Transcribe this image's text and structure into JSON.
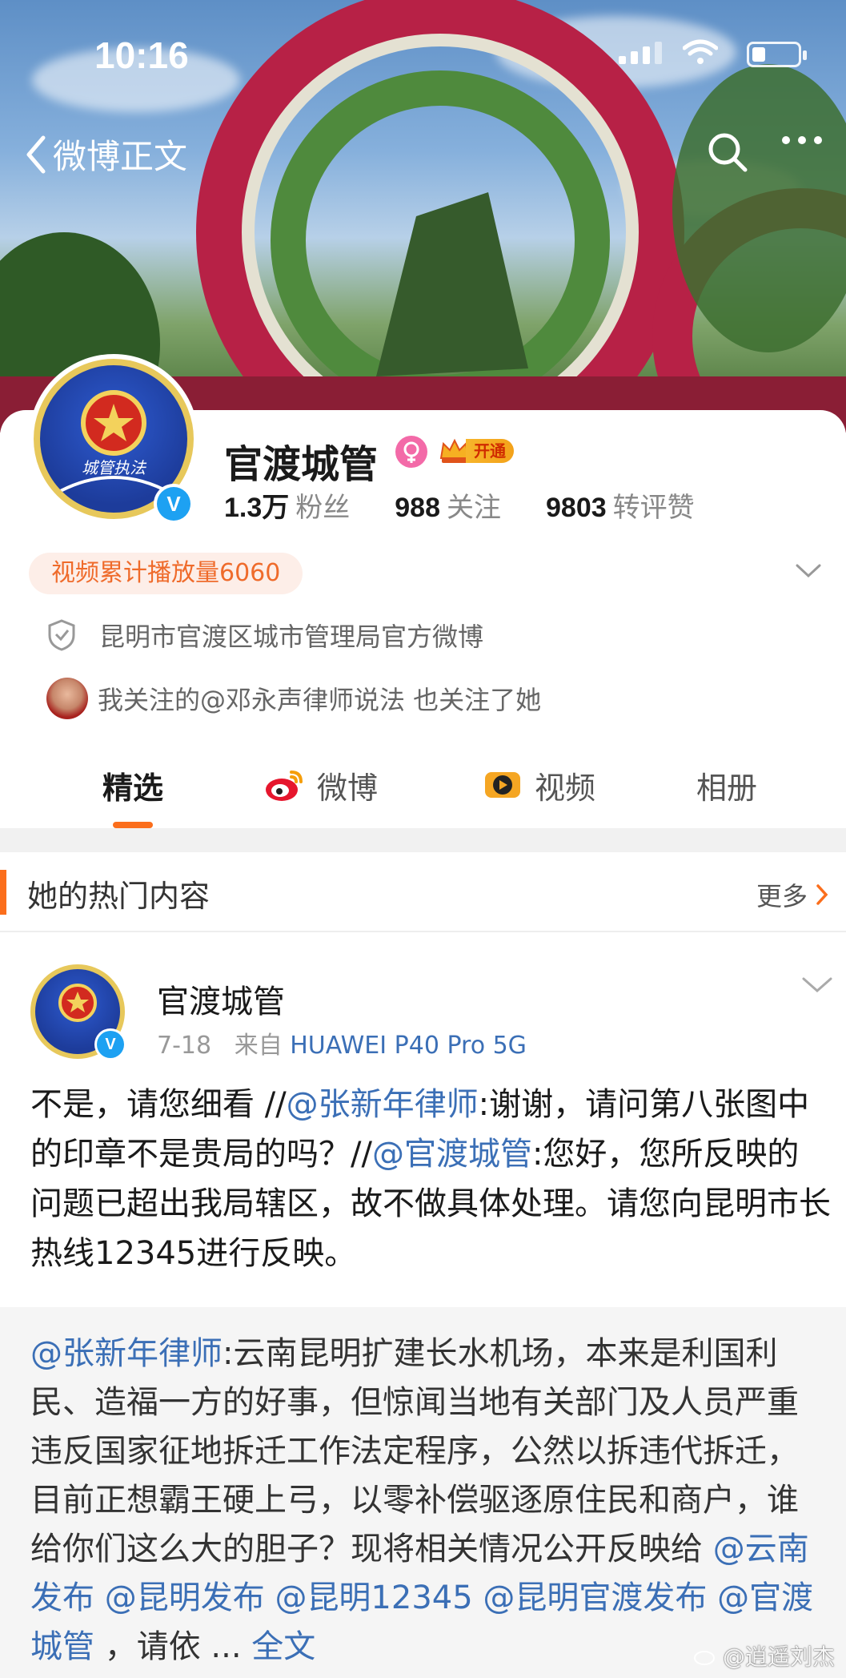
{
  "status_bar": {
    "time": "10:16"
  },
  "nav": {
    "back_label": "微博正文"
  },
  "profile": {
    "name": "官渡城管",
    "vip_label": "开通",
    "verified_mark": "V",
    "avatar_text": "城管执法",
    "stats": [
      {
        "value": "1.3万",
        "label": "粉丝"
      },
      {
        "value": "988",
        "label": "关注"
      },
      {
        "value": "9803",
        "label": "转评赞"
      }
    ],
    "video_badge": "视频累计播放量6060",
    "verify_text": "昆明市官渡区城市管理局官方微博",
    "mutual_text": "我关注的@邓永声律师说法  也关注了她"
  },
  "tabs": [
    {
      "label": "精选",
      "active": true
    },
    {
      "label": "微博",
      "icon": "weibo-icon"
    },
    {
      "label": "视频",
      "icon": "video-icon"
    },
    {
      "label": "相册"
    }
  ],
  "hot_section": {
    "title": "她的热门内容",
    "more_label": "更多"
  },
  "post": {
    "author": "官渡城管",
    "date": "7-18",
    "source_prefix": "来自",
    "device": "HUAWEI P40 Pro 5G",
    "text_parts": [
      {
        "t": "不是，请您细看 //"
      },
      {
        "t": "@张新年律师",
        "mention": true
      },
      {
        "t": ":谢谢，请问第八张图中的印章不是贵局的吗？//"
      },
      {
        "t": "@官渡城管",
        "mention": true
      },
      {
        "t": ":您好，您所反映的问题已超出我局辖区，故不做具体处理。请您向昆明市长热线12345进行反映。"
      }
    ]
  },
  "repost": {
    "parts": [
      {
        "t": "@张新年律师",
        "mention": true
      },
      {
        "t": ":云南昆明扩建长水机场，本来是利国利民、造福一方的好事，但惊闻当地有关部门及人员严重违反国家征地拆迁工作法定程序，公然以拆违代拆迁，目前正想霸王硬上弓，以零补偿驱逐原住民和商户，谁给你们这么大的胆子？现将相关情况公开反映给 "
      },
      {
        "t": "@云南发布",
        "mention": true
      },
      {
        "t": " "
      },
      {
        "t": "@昆明发布",
        "mention": true
      },
      {
        "t": " "
      },
      {
        "t": "@昆明12345",
        "mention": true
      },
      {
        "t": " "
      },
      {
        "t": "@昆明官渡发布",
        "mention": true
      },
      {
        "t": " "
      },
      {
        "t": "@官渡城管",
        "mention": true
      },
      {
        "t": " ，请依 ... "
      },
      {
        "t": "全文",
        "mention": true
      }
    ]
  },
  "watermark": "@逍遥刘杰",
  "colors": {
    "accent": "#fb6e1c",
    "link": "#3b6fb6",
    "verified": "#1da1f2"
  }
}
